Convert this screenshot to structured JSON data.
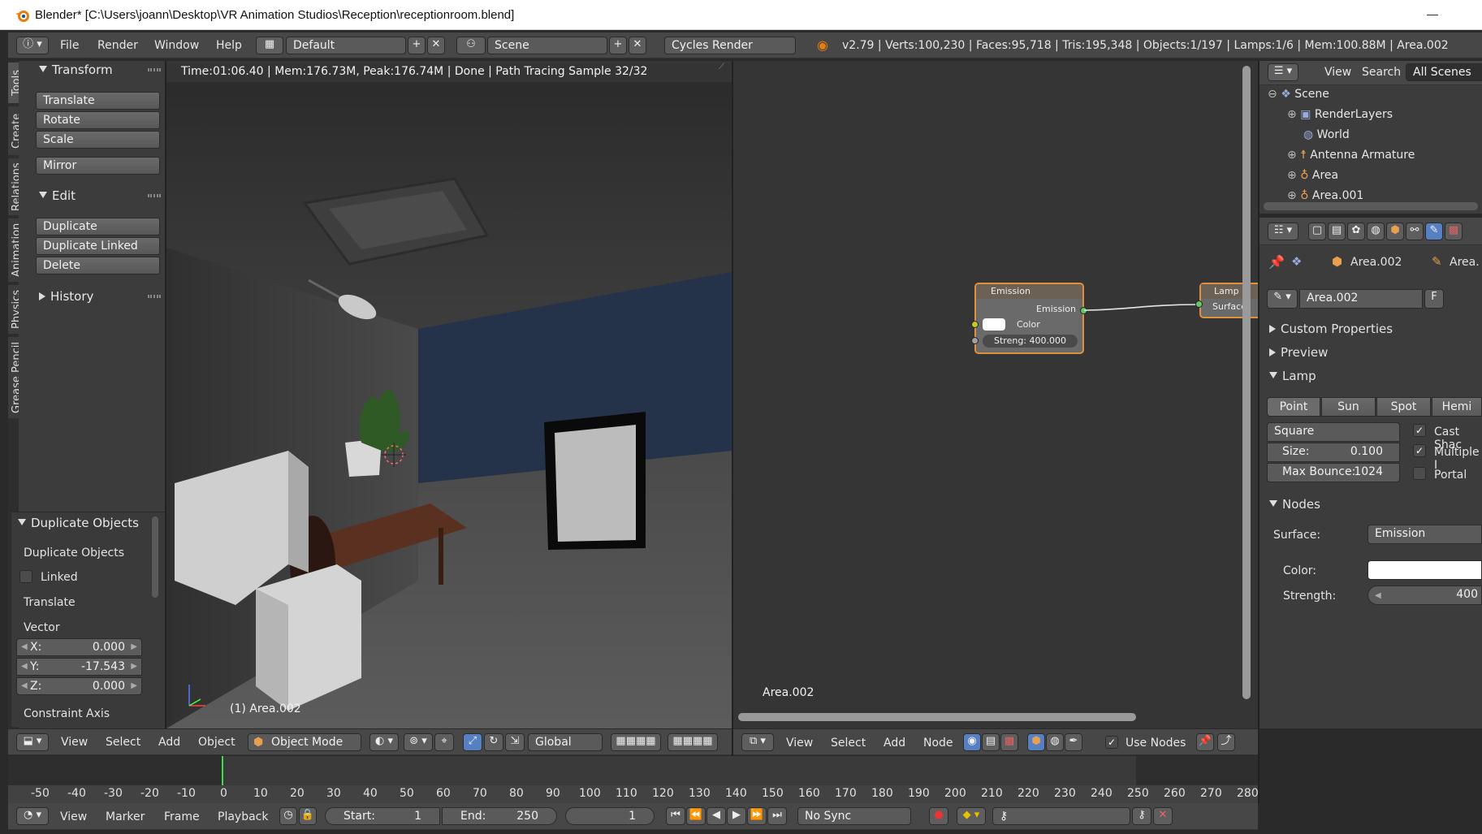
{
  "window": {
    "title": "Blender* [C:\\Users\\joann\\Desktop\\VR Animation Studios\\Reception\\receptionroom.blend]"
  },
  "info_header": {
    "menus": [
      "File",
      "Render",
      "Window",
      "Help"
    ],
    "screen_layout": "Default",
    "scene": "Scene",
    "render_engine": "Cycles Render",
    "stats": "v2.79 | Verts:100,230 | Faces:95,718 | Tris:195,348 | Objects:1/197 | Lamps:1/6 | Mem:100.88M | Area.002"
  },
  "tool_tabs": [
    "Tools",
    "Create",
    "Relations",
    "Animation",
    "Physics",
    "Grease Pencil"
  ],
  "tool_shelf": {
    "transform": {
      "title": "Transform",
      "buttons": [
        "Translate",
        "Rotate",
        "Scale",
        "Mirror"
      ]
    },
    "edit": {
      "title": "Edit",
      "buttons": [
        "Duplicate",
        "Duplicate Linked",
        "Delete"
      ]
    },
    "history": {
      "title": "History"
    }
  },
  "operator_panel": {
    "title": "Duplicate Objects",
    "op_label": "Duplicate Objects",
    "linked_label": "Linked",
    "translate_label": "Translate",
    "vector_label": "Vector",
    "vector": [
      {
        "axis": "X:",
        "value": "0.000"
      },
      {
        "axis": "Y:",
        "value": "-17.543"
      },
      {
        "axis": "Z:",
        "value": "0.000"
      }
    ],
    "constraint_label": "Constraint Axis"
  },
  "viewport": {
    "render_status": "Time:01:06.40 | Mem:176.73M, Peak:176.74M | Done | Path Tracing Sample 32/32",
    "object_label": "(1) Area.002",
    "header": {
      "menus": [
        "View",
        "Select",
        "Add",
        "Object"
      ],
      "mode": "Object Mode",
      "orientation": "Global"
    }
  },
  "node_editor": {
    "emission_node": {
      "title": "Emission",
      "output": "Emission",
      "color_label": "Color",
      "strength": "Streng: 400.000"
    },
    "output_node": {
      "title": "Lamp",
      "input": "Surface"
    },
    "object_label": "Area.002",
    "header": {
      "menus": [
        "View",
        "Select",
        "Add",
        "Node"
      ],
      "use_nodes": "Use Nodes"
    }
  },
  "outliner": {
    "header": {
      "menus": [
        "View",
        "Search"
      ],
      "filter": "All Scenes"
    },
    "rows": [
      "Scene",
      "RenderLayers",
      "World",
      "Antenna Armature",
      "Area",
      "Area.001"
    ]
  },
  "properties": {
    "breadcrumb": [
      "Area.002",
      "Area."
    ],
    "datablock": "Area.002",
    "fake_user": "F",
    "sections": {
      "custom": "Custom Properties",
      "preview": "Preview",
      "lamp": "Lamp",
      "nodes": "Nodes"
    },
    "lamp_types": [
      "Point",
      "Sun",
      "Spot",
      "Hemi"
    ],
    "shape": "Square",
    "size": {
      "label": "Size:",
      "value": "0.100"
    },
    "max_bounce": {
      "label": "Max Bounce:",
      "value": "1024"
    },
    "checks": [
      {
        "label": "Cast Shac",
        "checked": true
      },
      {
        "label": "Multiple I",
        "checked": true
      },
      {
        "label": "Portal",
        "checked": false
      }
    ],
    "surface_label": "Surface:",
    "surface_value": "Emission",
    "color_label": "Color:",
    "strength_label": "Strength:",
    "strength_value": "400"
  },
  "timeline": {
    "ticks": [
      "-50",
      "-40",
      "-30",
      "-20",
      "-10",
      "0",
      "10",
      "20",
      "30",
      "40",
      "50",
      "60",
      "70",
      "80",
      "90",
      "100",
      "110",
      "120",
      "130",
      "140",
      "150",
      "160",
      "170",
      "180",
      "190",
      "200",
      "210",
      "220",
      "230",
      "240",
      "250",
      "260",
      "270",
      "280"
    ],
    "header": {
      "menus": [
        "View",
        "Marker",
        "Frame",
        "Playback"
      ],
      "start_label": "Start:",
      "start": "1",
      "end_label": "End:",
      "end": "250",
      "current": "1",
      "sync": "No Sync"
    }
  },
  "colors": {
    "accent_blue": "#5680c2",
    "node_header": "#6b6154",
    "socket_yellow": "#c7c729",
    "socket_green": "#63c763",
    "frame_green": "#3fdd4a"
  }
}
